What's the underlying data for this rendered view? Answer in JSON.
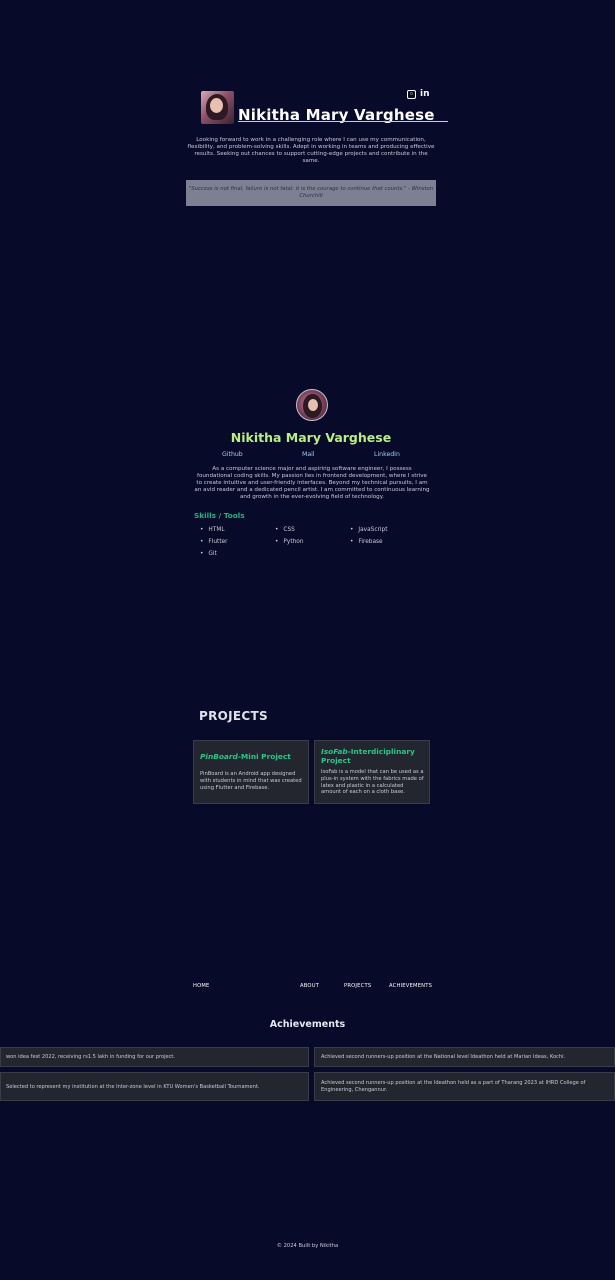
{
  "hero": {
    "name": "Nikitha Mary Varghese",
    "icons": [
      "github-icon",
      "linkedin-icon"
    ],
    "summary": "Looking forward to work in a challenging role where I can use my communication, flexibility, and problem-solving skills. Adept in working in teams and producing effective results. Seeking out chances to support cutting-edge projects and contribute in the same.",
    "quote": "\"Success is not final, failure is not fatal: it is the courage to continue that counts.\" - Winston Churchill"
  },
  "about": {
    "name": "Nikitha Mary Varghese",
    "links": {
      "github": "Github",
      "mail": "Mail",
      "linkedin": "LinkedIn"
    },
    "text": "As a computer science major and aspiring software engineer, I possess foundational coding skills. My passion lies in frontend development, where I strive to create intuitive and user-friendly interfaces. Beyond my technical pursuits, I am an avid reader and a dedicated pencil artist. I am committed to continuous learning and growth in the ever-evolving field of technology.",
    "skills_title": "Skills / Tools",
    "skills": [
      "HTML",
      "CSS",
      "JavaScript",
      "Flutter",
      "Python",
      "Firebase",
      "Git"
    ]
  },
  "projects": {
    "title": "PROJECTS",
    "items": [
      {
        "title_em": "PinBoard",
        "title_rest": "-Mini Project",
        "body": "PinBoard is an Android app designed with students in mind that was created using Flutter and Firebase."
      },
      {
        "title_em": "IsoFab",
        "title_rest": "-Interdiciplinary Project",
        "body": "IsoFab is a model that can be used as a plus-in system with the fabrics made of latex and plastic in a calculated amount of each on a cloth base."
      }
    ]
  },
  "nav": {
    "home": "HOME",
    "about": "ABOUT",
    "projects": "PROJECTS",
    "achievements": "ACHIEVEMENTS"
  },
  "achievements": {
    "title": "Achievements",
    "items": [
      "won idea fest 2022, receiving rs1.5 lakh in funding for our project.",
      "Achieved second runners-up position at the National level Ideathon held at Marian Ideas, Kochi.",
      "Selected to represent my institution at the Inter-zone level in KTU Women's Basketball Tournament.",
      "Achieved second runners-up position at the Ideathon held as a part of Tharang 2023 at IHRD College of Engineering, Chengannur."
    ]
  },
  "footer": "© 2024 Built by Nikitha"
}
